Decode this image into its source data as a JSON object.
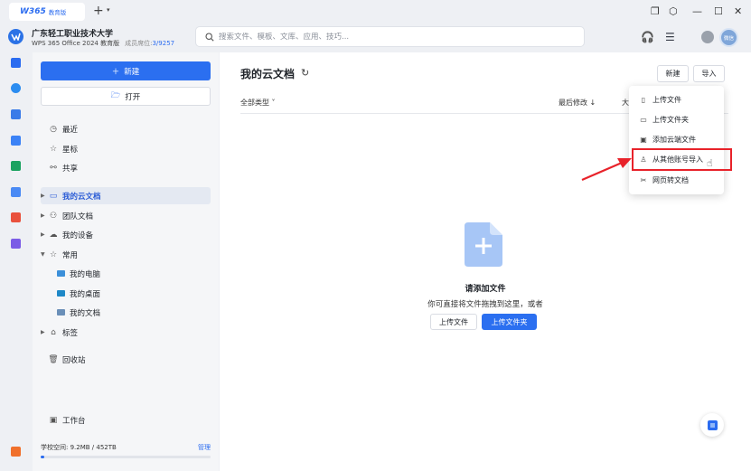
{
  "titlebar": {
    "tab_logo": "W365",
    "tab_sub": "教育版",
    "new_tab": "+",
    "tab_menu": "▾"
  },
  "header": {
    "org_name": "广东轻工职业技术大学",
    "org_product": "WPS 365 Office 2024 教育版",
    "rank_label": "成员席位:",
    "rank_value": "3/9257",
    "search_placeholder": "搜索文件、模板、文库、应用、技巧...",
    "avatar_text": "微信"
  },
  "sidebar": {
    "new_label": "新建",
    "open_label": "打开",
    "items": [
      {
        "label": "最近",
        "icon": "clock-icon"
      },
      {
        "label": "星标",
        "icon": "star-icon"
      },
      {
        "label": "共享",
        "icon": "share-icon"
      },
      {
        "label": "我的云文档",
        "icon": "folder-icon"
      },
      {
        "label": "团队文档",
        "icon": "team-icon"
      },
      {
        "label": "我的设备",
        "icon": "cloud-device-icon"
      },
      {
        "label": "常用",
        "icon": "star-outline-icon"
      },
      {
        "label": "我的电脑",
        "icon": "computer-icon"
      },
      {
        "label": "我的桌面",
        "icon": "desktop-folder-icon"
      },
      {
        "label": "我的文档",
        "icon": "documents-folder-icon"
      },
      {
        "label": "标签",
        "icon": "tag-icon"
      },
      {
        "label": "回收站",
        "icon": "trash-icon"
      },
      {
        "label": "工作台",
        "icon": "workbench-icon"
      }
    ],
    "storage_label": "学校空间: 9.2MB / 452TB",
    "storage_manage": "管理",
    "storage_fraction": 0.02
  },
  "main": {
    "title": "我的云文档",
    "new_btn": "新建",
    "import_btn": "导入",
    "filter": "全部类型",
    "sort": "最后修改",
    "size_col": "大",
    "empty_title": "请添加文件",
    "empty_sub": "你可直接将文件拖拽到这里，或者",
    "upload_file": "上传文件",
    "upload_folder": "上传文件夹"
  },
  "dropdown": {
    "items": [
      {
        "label": "上传文件",
        "icon": "upload-file-icon"
      },
      {
        "label": "上传文件夹",
        "icon": "upload-folder-icon"
      },
      {
        "label": "添加云端文件",
        "icon": "cloud-file-icon"
      },
      {
        "label": "从其他账号导入",
        "icon": "account-icon"
      },
      {
        "label": "网页转文档",
        "icon": "scissors-icon"
      }
    ]
  },
  "colors": {
    "accent": "#2b6ff0",
    "highlight": "#e8222a"
  }
}
